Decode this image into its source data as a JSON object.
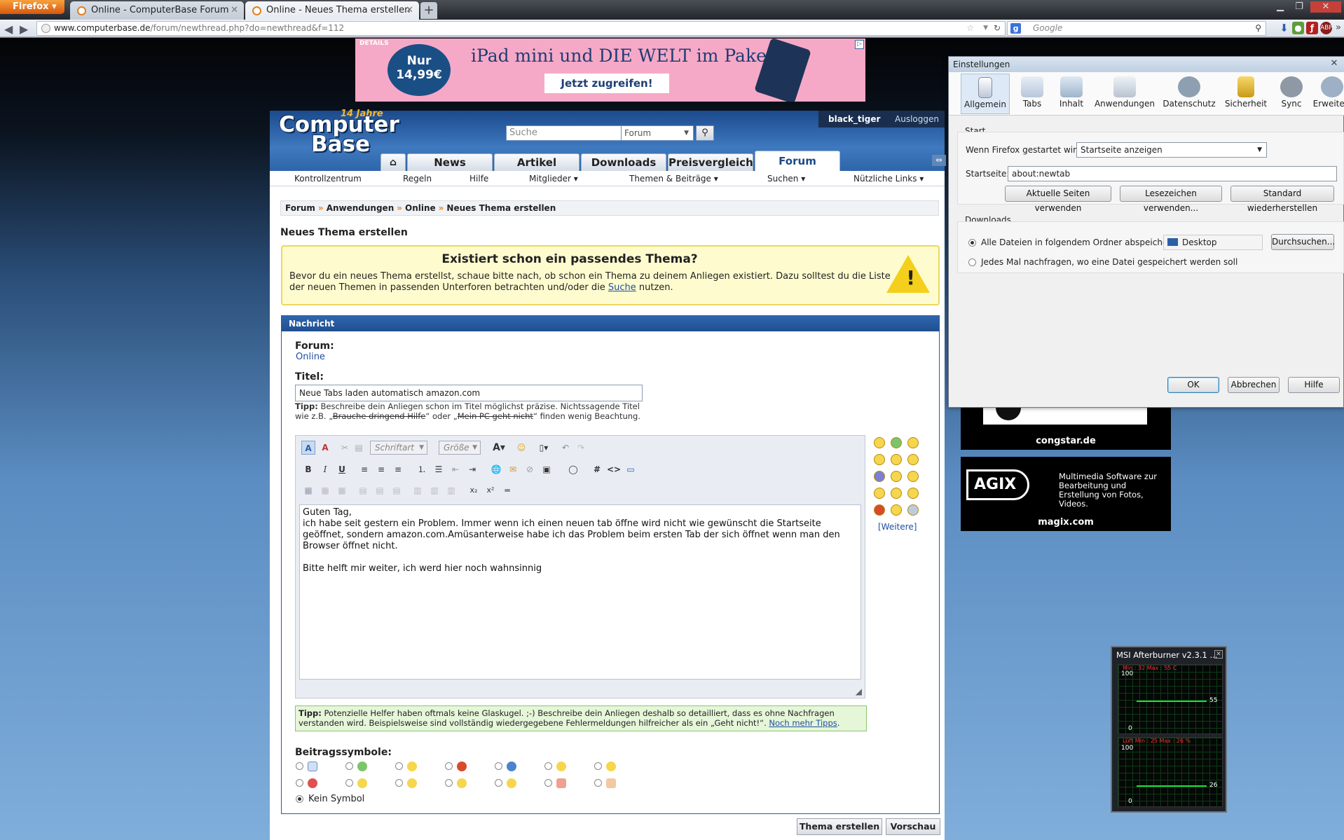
{
  "browser": {
    "menu_button": "Firefox",
    "tabs": [
      {
        "title": "Online - ComputerBase Forum"
      },
      {
        "title": "Online - Neues Thema erstellen"
      }
    ],
    "new_tab": "+",
    "url_domain": "www.computerbase.de",
    "url_path": "/forum/newthread.php?do=newthread&f=112",
    "search_placeholder": "Google",
    "search_engine": "g-icon"
  },
  "ad_banner": {
    "label": "DETAILS",
    "price_line1": "Nur",
    "price_line2": "14,99€",
    "headline": "iPad mini und DIE WELT im Paket.",
    "cta": "Jetzt zugreifen!"
  },
  "forum": {
    "logo_line1": "Computer",
    "logo_line2": "Base",
    "logo_badge": "14 Jahre",
    "user": "black_tiger",
    "logout": "Ausloggen",
    "search_placeholder": "Suche",
    "search_scope": "Forum",
    "main_tabs": [
      "News",
      "Artikel",
      "Downloads",
      "Preisvergleich",
      "Forum"
    ],
    "active_tab": "Forum",
    "subnav": [
      "Kontrollzentrum",
      "Regeln",
      "Hilfe",
      "Mitglieder ▾",
      "Themen & Beiträge ▾",
      "Suchen ▾",
      "Nützliche Links ▾"
    ],
    "breadcrumb": [
      "Forum",
      "Anwendungen",
      "Online",
      "Neues Thema erstellen"
    ],
    "page_title": "Neues Thema erstellen",
    "warning_title": "Existiert schon ein passendes Thema?",
    "warning_text_a": "Bevor du ein neues Thema erstellst, schaue bitte nach, ob schon ein Thema zu deinem Anliegen existiert. Dazu solltest du die Liste der neuen Themen in passenden Unterforen betrachten und/oder die ",
    "warning_link": "Suche",
    "warning_text_b": " nutzen.",
    "box_header": "Nachricht",
    "forum_label": "Forum:",
    "forum_value": "Online",
    "title_label": "Titel:",
    "title_value": "Neue Tabs laden automatisch amazon.com",
    "tip_label": "Tipp:",
    "title_tip_a": " Beschreibe dein Anliegen schon im Titel möglichst präzise. Nichtssagende Titel wie z.B. „",
    "title_tip_strike1": "Brauche dringend Hilfe",
    "title_tip_b": "“ oder „",
    "title_tip_strike2": "Mein PC geht nicht",
    "title_tip_c": "“ finden wenig Beachtung.",
    "font_select": "Schriftart",
    "size_select": "Größe",
    "message": "Guten Tag,\nich habe seit gestern ein Problem. Immer wenn ich einen neuen tab öffne wird nicht wie gewünscht die Startseite geöffnet, sondern amazon.com.Amüsanterweise habe ich das Problem beim ersten Tab der sich öffnet wenn man den Browser öffnet nicht.\n\nBitte helft mir weiter, ich werd hier noch wahnsinnig",
    "more_smilies": "[Weitere]",
    "tip2_label": "Tipp:",
    "tip2_text": " Potenzielle Helfer haben oftmals keine Glaskugel. ;-) Beschreibe dein Anliegen deshalb so detailliert, dass es ohne Nachfragen verstanden wird. Beispielsweise sind vollständig wiedergegebene Fehlermeldungen hilfreicher als ein „Geht nicht!“. ",
    "tip2_link": "Noch mehr Tipps",
    "tip2_end": ".",
    "post_icons_label": "Beitragssymbole:",
    "no_symbol": "Kein Symbol",
    "submit": "Thema erstellen",
    "preview": "Vorschau"
  },
  "side_ads": [
    {
      "caption": "congstar.de"
    },
    {
      "logo": "AGIX",
      "text": "Multimedia Software zur Bearbeitung und Erstellung von Fotos, Videos.",
      "caption": "magix.com"
    }
  ],
  "dialog": {
    "title": "Einstellungen",
    "tabs": [
      "Allgemein",
      "Tabs",
      "Inhalt",
      "Anwendungen",
      "Datenschutz",
      "Sicherheit",
      "Sync",
      "Erweitert"
    ],
    "selected_tab": "Allgemein",
    "start_group": "Start",
    "start_label": "Wenn Firefox gestartet wird:",
    "start_value": "Startseite anzeigen",
    "home_label": "Startseite:",
    "home_value": "about:newtab",
    "btn_current": "Aktuelle Seiten verwenden",
    "btn_bookmark": "Lesezeichen verwenden...",
    "btn_default": "Standard wiederherstellen",
    "downloads_group": "Downloads",
    "dl_opt1": "Alle Dateien in folgendem Ordner abspeichern:",
    "dl_folder": "Desktop",
    "dl_browse": "Durchsuchen...",
    "dl_opt2": "Jedes Mal nachfragen, wo eine Datei gespeichert werden soll",
    "ok": "OK",
    "cancel": "Abbrechen",
    "help": "Hilfe"
  },
  "afterburner": {
    "title": "MSI Afterburner v2.3.1 ...",
    "g1_max": "100",
    "g1_min": "0",
    "g1_val": "55",
    "g1_head": "Min : 32 Max : 55 C",
    "g2_max": "100",
    "g2_min": "0",
    "g2_val": "26",
    "g2_head": "Lüft Min : 25 Max : 26 %"
  }
}
